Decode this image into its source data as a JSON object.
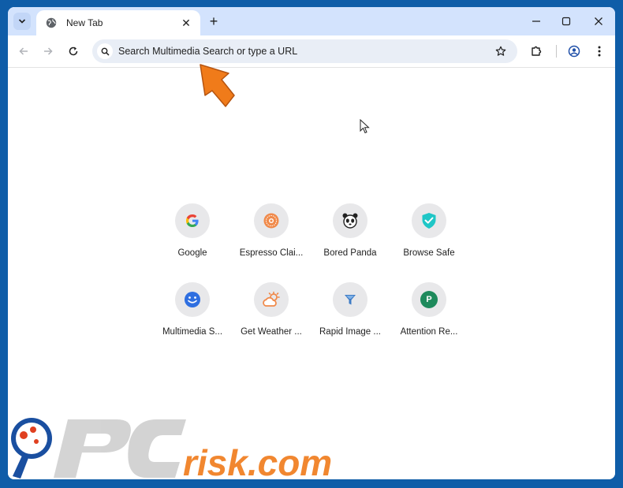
{
  "browser": {
    "tab": {
      "title": "New Tab",
      "close_glyph": "✕"
    },
    "new_tab_glyph": "+",
    "window_controls": {
      "minimize": "—",
      "maximize": "☐",
      "close": "✕"
    }
  },
  "toolbar": {
    "omnibox_placeholder": "Search Multimedia Search or type a URL"
  },
  "shortcuts": [
    {
      "label": "Google",
      "icon": "google-icon",
      "initial": "G",
      "color": "#4285f4"
    },
    {
      "label": "Espresso Clai...",
      "icon": "espresso-icon",
      "initial": "",
      "color": "#f08a4b"
    },
    {
      "label": "Bored Panda",
      "icon": "panda-icon",
      "initial": "",
      "color": "#222222"
    },
    {
      "label": "Browse Safe",
      "icon": "shield-icon",
      "initial": "",
      "color": "#1fc6c6"
    },
    {
      "label": "Multimedia S...",
      "icon": "smiley-icon",
      "initial": "",
      "color": "#2f6fe0"
    },
    {
      "label": "Get Weather ...",
      "icon": "weather-icon",
      "initial": "",
      "color": "#f08a4b"
    },
    {
      "label": "Rapid Image ...",
      "icon": "funnel-icon",
      "initial": "",
      "color": "#3e7bc5"
    },
    {
      "label": "Attention Re...",
      "icon": "letter-p-icon",
      "initial": "P",
      "color": "#1e8a5c"
    }
  ],
  "watermark": {
    "text": "PCrisk.com",
    "colors": {
      "brand_gray": "#cfcfcf",
      "brand_orange": "#f07b1a",
      "brand_blue": "#1a4fa0"
    }
  },
  "colors": {
    "background": "#0f5da8",
    "tabstrip": "#d3e3fd",
    "omnibox": "#e9eef6",
    "arrow": "#f07b1a"
  }
}
